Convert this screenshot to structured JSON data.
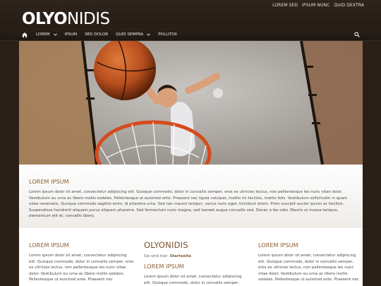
{
  "top_links": [
    "LOREM SED",
    "IPSUM NUNC",
    "QUID DEXTRA"
  ],
  "logo": {
    "bold": "OLYO",
    "light": "NIDIS"
  },
  "nav": {
    "items": [
      {
        "label": "LOREM",
        "has_dropdown": true
      },
      {
        "label": "IPSUM",
        "has_dropdown": false
      },
      {
        "label": "SED DOLOR",
        "has_dropdown": false
      },
      {
        "label": "QUID SEMPRA",
        "has_dropdown": true
      },
      {
        "label": "POLLITOX",
        "has_dropdown": false
      }
    ]
  },
  "intro": {
    "title": "LOREM IPSUM",
    "text": "Lorem ipsum dolor sit amet, consectetur adipiscing elit. Quisque commodo, dolor in convallis semper, eros ex ultricies lectus, non pellentesque leo nunc vitae dolor. Vestibulum eu urna ac libero mollis sodales. Pellentesque ut euismod ante. Praesent nec ligula volutpat, mattis mi facilisis, mattis felis. Vestibulum sollicitudin in quam vitae venenatis. Quisque commodo sagittis enim, id pharetra urna. Sed nec mauris tempor, varius nunc eget, tincidunt lorem. Proin suscipit auctor ipsum ac facilisis. Suspendisse hendrerit aliquam purus aliquam pharetra. Sed fermentum nunc magna, sed laoreet augue convallis sed. Donec a leo odio. Mauris ut massa tempus, elementum elit et, convallis libero."
  },
  "col1": {
    "title": "LOREM IPSUM",
    "text": "Lorem ipsum dolor sit amet, consectetur adipiscing elit. Quisque commodo, dolor in convallis semper, eros ex ultricies lectus, non pellentesque leo nunc vitae dolor. Vestibulum eu urna ac libero mollis sodales. Pellentesque ut euismod ante. Praesent nec"
  },
  "col2": {
    "heading": "OLYONIDIS",
    "breadcrumb_prefix": "Sie sind hier:",
    "breadcrumb_link": "Startseite",
    "title": "LOREM IPSUM",
    "text": "Lorem ipsum dolor sit amet, consectetur adipiscing elit. Quisque commodo, dolor in convallis semper,"
  },
  "col3": {
    "title": "LOREM IPSUM",
    "text": "Lorem ipsum dolor sit amet, consectetur adipiscing elit. Quisque commodo, dolor in convallis semper, eros ex ultricies lectus, non pellentesque leo nunc vitae dolor. Vestibulum eu urna ac libero mollis sodales. Pellentesque ut euismod ante. Praesent nec"
  },
  "icons": {
    "home": "home-icon",
    "search": "search-icon",
    "dropdown": "chevron-down-icon"
  },
  "colors": {
    "accent": "#8b5a2b",
    "background": "#2b2018",
    "nav_text": "#f1ebe4"
  }
}
